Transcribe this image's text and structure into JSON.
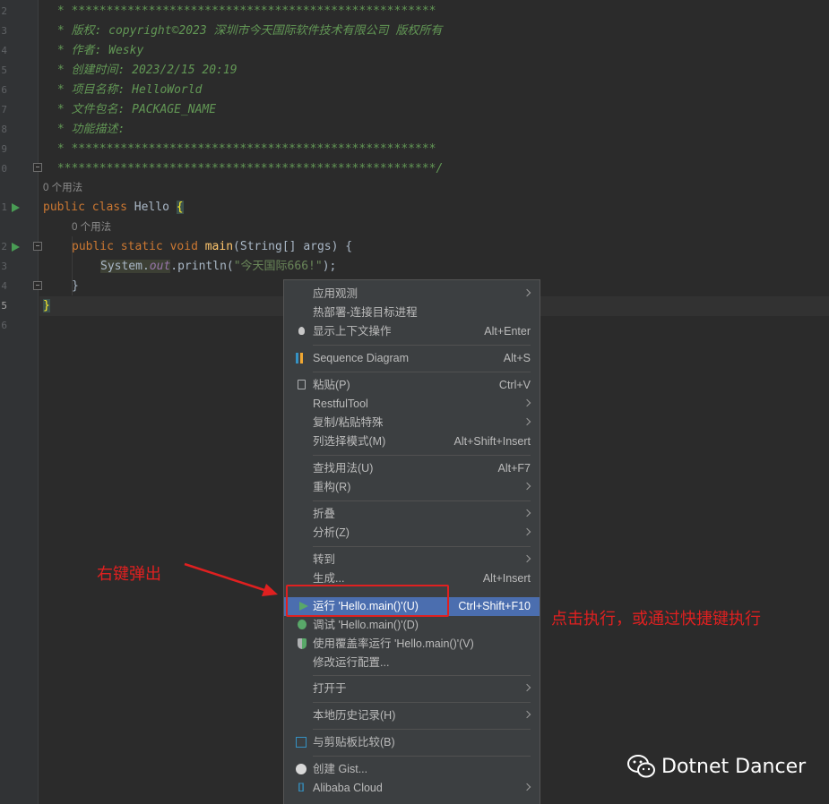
{
  "gutter": {
    "line_numbers": [
      "2",
      "3",
      "4",
      "5",
      "6",
      "7",
      "8",
      "9",
      "0",
      "1",
      "2",
      "3",
      "4",
      "5",
      "6"
    ],
    "active_line_index": 13
  },
  "code": {
    "comment_lines": [
      " * ****************************************************",
      " * 版权: copyright©2023 深圳市今天国际软件技术有限公司 版权所有",
      " * 作者: Wesky",
      " * 创建时间: 2023/2/15 20:19",
      " * 项目名称: HelloWorld",
      " * 文件包名: PACKAGE_NAME",
      " * 功能描述:",
      " * ****************************************************",
      " ******************************************************/"
    ],
    "hint_class_usages": "0 个用法",
    "class_decl": {
      "kw1": "public",
      "kw2": "class",
      "name": "Hello",
      "brace": "{"
    },
    "hint_method_usages": "0 个用法",
    "method_decl": {
      "kw1": "public",
      "kw2": "static",
      "kw3": "void",
      "name": "main",
      "params": "(String[] args) {"
    },
    "println": {
      "sys": "System",
      "dot1": ".",
      "out": "out",
      "call": ".println(",
      "str": "\"今天国际666!\"",
      "end": ");"
    },
    "close_method": "}",
    "close_class": "}"
  },
  "context_menu": {
    "items": [
      {
        "label": "应用观测",
        "shortcut": "",
        "submenu": true,
        "icon": ""
      },
      {
        "label": "热部署-连接目标进程",
        "shortcut": "",
        "submenu": false,
        "icon": ""
      },
      {
        "label": "显示上下文操作",
        "shortcut": "Alt+Enter",
        "submenu": false,
        "icon": "lightbulb-icon"
      },
      {
        "label": "Sequence Diagram",
        "shortcut": "Alt+S",
        "submenu": false,
        "icon": "sequence-diagram-icon"
      },
      {
        "label": "粘贴(P)",
        "shortcut": "Ctrl+V",
        "submenu": false,
        "icon": "paste-icon"
      },
      {
        "label": "RestfulTool",
        "shortcut": "",
        "submenu": true,
        "icon": ""
      },
      {
        "label": "复制/粘贴特殊",
        "shortcut": "",
        "submenu": true,
        "icon": ""
      },
      {
        "label": "列选择模式(M)",
        "shortcut": "Alt+Shift+Insert",
        "submenu": false,
        "icon": ""
      },
      {
        "label": "查找用法(U)",
        "shortcut": "Alt+F7",
        "submenu": false,
        "icon": ""
      },
      {
        "label": "重构(R)",
        "shortcut": "",
        "submenu": true,
        "icon": ""
      },
      {
        "label": "折叠",
        "shortcut": "",
        "submenu": true,
        "icon": ""
      },
      {
        "label": "分析(Z)",
        "shortcut": "",
        "submenu": true,
        "icon": ""
      },
      {
        "label": "转到",
        "shortcut": "",
        "submenu": true,
        "icon": ""
      },
      {
        "label": "生成...",
        "shortcut": "Alt+Insert",
        "submenu": false,
        "icon": ""
      },
      {
        "label": "运行 'Hello.main()'(U)",
        "shortcut": "Ctrl+Shift+F10",
        "submenu": false,
        "icon": "run-play-icon",
        "selected": true
      },
      {
        "label": "调试 'Hello.main()'(D)",
        "shortcut": "",
        "submenu": false,
        "icon": "debug-bug-icon"
      },
      {
        "label": "使用覆盖率运行 'Hello.main()'(V)",
        "shortcut": "",
        "submenu": false,
        "icon": "coverage-shield-icon"
      },
      {
        "label": "修改运行配置...",
        "shortcut": "",
        "submenu": false,
        "icon": ""
      },
      {
        "label": "打开于",
        "shortcut": "",
        "submenu": true,
        "icon": ""
      },
      {
        "label": "本地历史记录(H)",
        "shortcut": "",
        "submenu": true,
        "icon": ""
      },
      {
        "label": "与剪贴板比较(B)",
        "shortcut": "",
        "submenu": false,
        "icon": "compare-clipboard-icon"
      },
      {
        "label": "创建 Gist...",
        "shortcut": "",
        "submenu": false,
        "icon": "github-icon"
      },
      {
        "label": "Alibaba Cloud",
        "shortcut": "",
        "submenu": true,
        "icon": "alibaba-cloud-icon"
      }
    ]
  },
  "annotations": {
    "right_click_popup": "右键弹出",
    "click_to_run": "点击执行，或通过快捷键执行",
    "highlight_color": "#e02020"
  },
  "watermark": {
    "text": "Dotnet Dancer",
    "icon": "wechat-icon"
  },
  "colors": {
    "editor_bg": "#2b2b2b",
    "menu_bg": "#3c3f41",
    "selection": "#4b6eaf",
    "comment": "#629755",
    "keyword": "#cc7832"
  }
}
